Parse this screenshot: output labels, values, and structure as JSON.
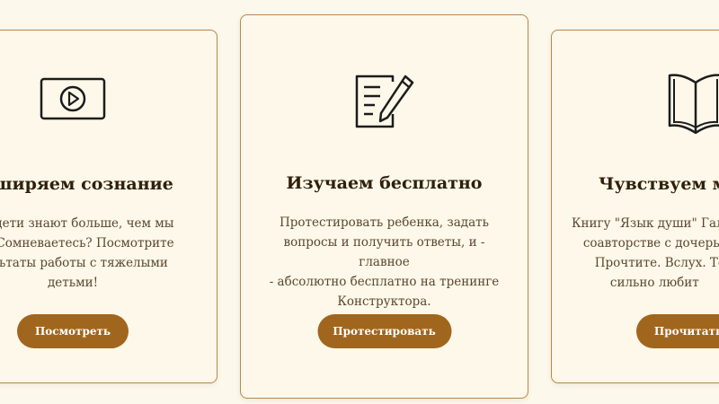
{
  "cards": [
    {
      "title": "асширяем сознание",
      "description": "ши дети знают больше, чем мы\nем. Сомневаетесь? Посмотрите\nзультаты работы с тяжелыми\nдетьми!",
      "button": "Посмотреть",
      "icon": "video-play-icon"
    },
    {
      "title": "Изучаем бесплатно",
      "description": "Протестировать ребенка, задать\nвопросы и получить ответы, и - главное\n- абсолютно бесплатно на тренинге\nКонструктора.",
      "button": "Протестировать",
      "icon": "document-pen-icon"
    },
    {
      "title": "Чувствуем му",
      "description": "Книгу \"Язык души\" Гали\n   соавторстве с дочерь\n      Прочтите. Вслух. Тому,\n          сильно любит",
      "button": "Прочитать",
      "icon": "open-book-icon"
    }
  ],
  "colors": {
    "background": "#fcf8ec",
    "card_border": "#b48a4e",
    "button": "#a1661e",
    "title": "#2f1f0c",
    "text": "#5a4630"
  }
}
